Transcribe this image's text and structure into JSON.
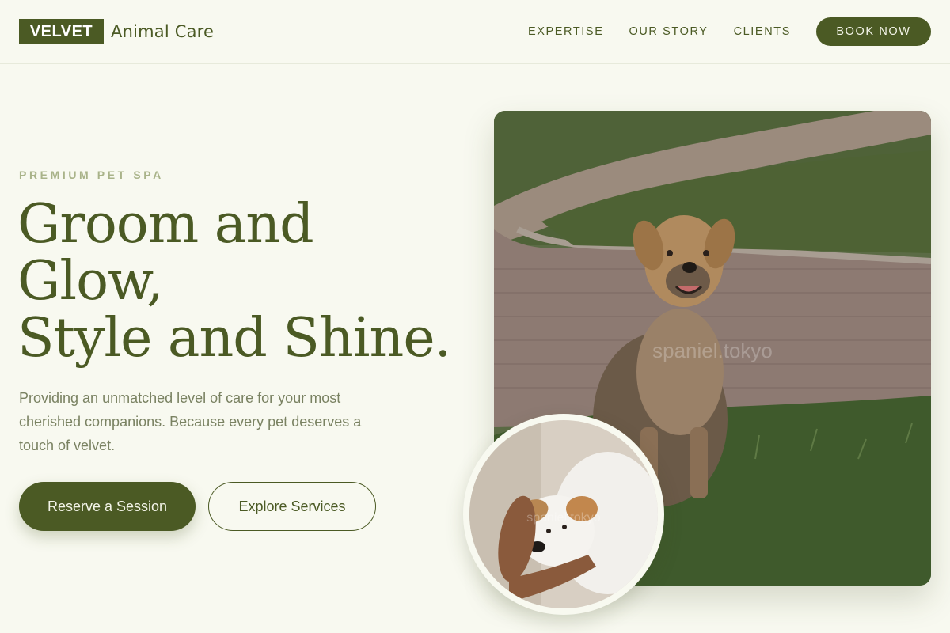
{
  "header": {
    "brand_box": "VELVET",
    "brand_sub": "Animal Care",
    "nav": [
      {
        "label": "EXPERTISE"
      },
      {
        "label": "OUR STORY"
      },
      {
        "label": "CLIENTS"
      }
    ],
    "cta_label": "BOOK NOW"
  },
  "hero": {
    "eyebrow": "PREMIUM PET SPA",
    "headline": [
      "Groom and",
      "Glow,",
      "Style and Shine."
    ],
    "lead": "Providing an unmatched level of care for your most cherished companions. Because every pet deserves a touch of velvet.",
    "primary_button": "Reserve a Session",
    "secondary_button": "Explore Services",
    "main_image_watermark": "spaniel.tokyo",
    "inset_image_watermark": "spaniel.tokyo"
  },
  "colors": {
    "brand": "#4b5a24",
    "background": "#f8f9f0",
    "eyebrow": "#a9b389",
    "body_text": "#7a8262"
  }
}
